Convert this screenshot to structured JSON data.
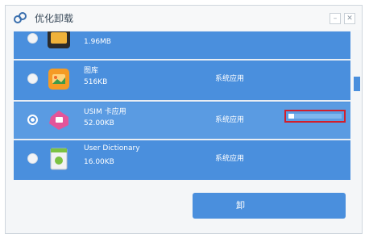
{
  "window": {
    "title": "优化卸载"
  },
  "controls": {
    "minimize_icon": "minimize-icon",
    "close_icon": "close-icon"
  },
  "apps": [
    {
      "name": "",
      "size": "1.96MB",
      "type": "",
      "icon": "game-icon",
      "selected": false
    },
    {
      "name": "图库",
      "size": "516KB",
      "type": "系统应用",
      "icon": "gallery-icon",
      "selected": false
    },
    {
      "name": "USIM 卡应用",
      "size": "52.00KB",
      "type": "系统应用",
      "icon": "sim-card-icon",
      "selected": true,
      "progress": 0.1
    },
    {
      "name": "User Dictionary",
      "size": "16.00KB",
      "type": "系统应用",
      "icon": "dictionary-icon",
      "selected": false
    }
  ],
  "action": {
    "label": "卸"
  },
  "colors": {
    "accent": "#4a8fdd",
    "highlight_border": "#d21e2b"
  }
}
